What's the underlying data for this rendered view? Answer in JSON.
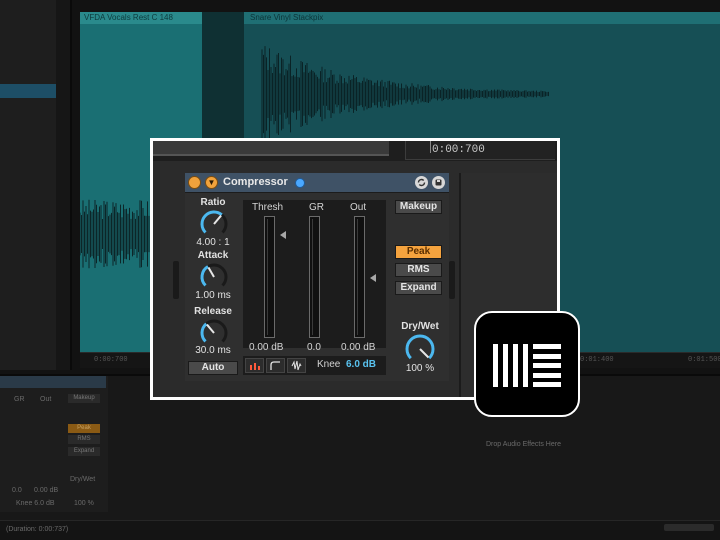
{
  "background": {
    "clip_a_name": "VFDA Vocals Rest C 148",
    "clip_b_name": "Snare Vinyl Stackpix",
    "ruler": [
      "0:00:700",
      "0:01:400",
      "0:01:500"
    ],
    "mini_device": {
      "col_gr": "GR",
      "col_out": "Out",
      "val_gr": "0.0",
      "val_out": "0.00 dB",
      "knee": "Knee 6.0 dB",
      "makeup": "Makeup",
      "peak": "Peak",
      "rms": "RMS",
      "expand": "Expand",
      "drywet": "Dry/Wet",
      "drywet_value": "100 %"
    },
    "drop_text": "Drop Audio Effects Here",
    "status": "(Duration: 0:00:737)"
  },
  "frame": {
    "time_readout": "0:00:700"
  },
  "device": {
    "title": "Compressor",
    "fold_glyph": "▼",
    "header_icons": [
      "loop-icon",
      "save-icon"
    ],
    "ratio": {
      "label": "Ratio",
      "value": "4.00 : 1"
    },
    "attack": {
      "label": "Attack",
      "value": "1.00 ms"
    },
    "release": {
      "label": "Release",
      "value": "30.0 ms"
    },
    "auto_label": "Auto",
    "meters": {
      "thresh_label": "Thresh",
      "gr_label": "GR",
      "out_label": "Out",
      "thresh_value": "0.00 dB",
      "gr_value": "0.0",
      "out_value": "0.00 dB"
    },
    "graph_buttons": [
      "collapse-icon",
      "curve-icon",
      "activity-icon"
    ],
    "knee_label": "Knee",
    "knee_value": "6.0 dB",
    "makeup_label": "Makeup",
    "modes": {
      "peak": "Peak",
      "rms": "RMS",
      "expand": "Expand",
      "active": "peak"
    },
    "drywet": {
      "label": "Dry/Wet",
      "value": "100 %"
    }
  },
  "logo": {
    "name": "ableton-live-logo"
  },
  "colors": {
    "accent_orange": "#f5a33e",
    "knob_blue": "#4cb8ef",
    "title_bar": "#3f5266",
    "clip_teal": "#1a6f73"
  }
}
